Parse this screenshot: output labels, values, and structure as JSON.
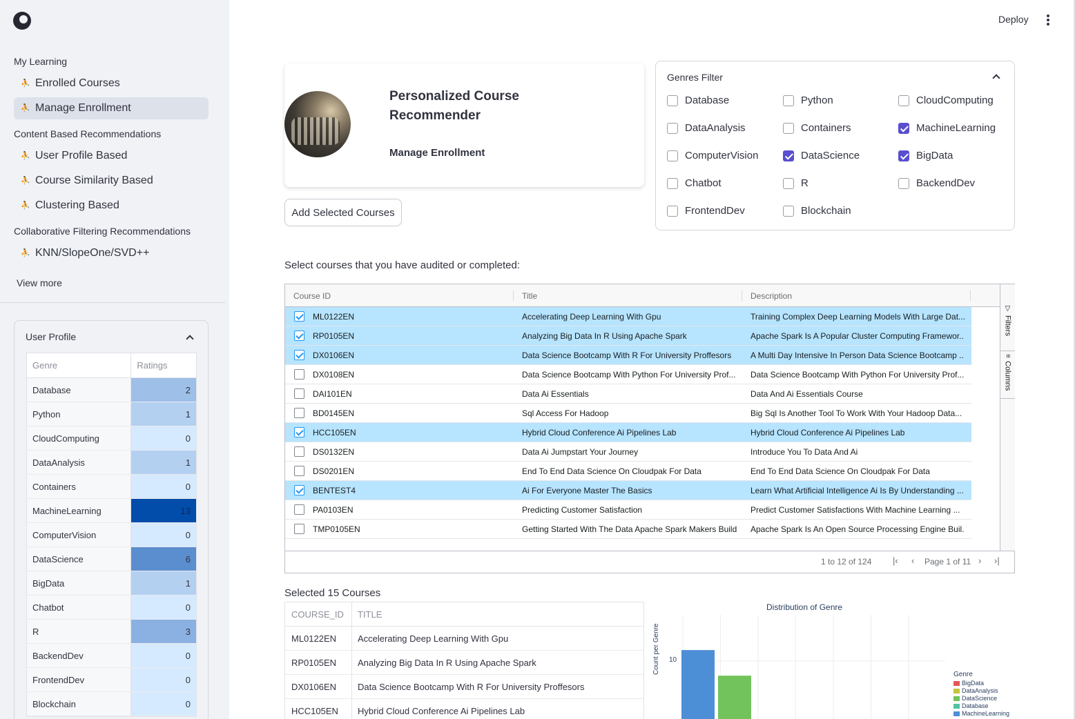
{
  "sidebar": {
    "sections": [
      {
        "title": "My Learning",
        "items": [
          {
            "label": "Enrolled Courses",
            "active": false
          },
          {
            "label": "Manage Enrollment",
            "active": true
          }
        ]
      },
      {
        "title": "Content Based Recommendations",
        "items": [
          {
            "label": "User Profile Based",
            "active": false
          },
          {
            "label": "Course Similarity Based",
            "active": false
          },
          {
            "label": "Clustering Based",
            "active": false
          }
        ]
      },
      {
        "title": "Collaborative Filtering Recommendations",
        "items": [
          {
            "label": "KNN/SlopeOne/SVD++",
            "active": false
          }
        ]
      }
    ],
    "view_more": "View more",
    "user_profile": {
      "title": "User Profile",
      "columns": [
        "Genre",
        "Ratings"
      ],
      "rows": [
        {
          "genre": "Database",
          "rating": 2
        },
        {
          "genre": "Python",
          "rating": 1
        },
        {
          "genre": "CloudComputing",
          "rating": 0
        },
        {
          "genre": "DataAnalysis",
          "rating": 1
        },
        {
          "genre": "Containers",
          "rating": 0
        },
        {
          "genre": "MachineLearning",
          "rating": 13
        },
        {
          "genre": "ComputerVision",
          "rating": 0
        },
        {
          "genre": "DataScience",
          "rating": 6
        },
        {
          "genre": "BigData",
          "rating": 1
        },
        {
          "genre": "Chatbot",
          "rating": 0
        },
        {
          "genre": "R",
          "rating": 3
        },
        {
          "genre": "BackendDev",
          "rating": 0
        },
        {
          "genre": "FrontendDev",
          "rating": 0
        },
        {
          "genre": "Blockchain",
          "rating": 0
        }
      ]
    }
  },
  "header": {
    "deploy": "Deploy"
  },
  "card": {
    "title": "Personalized Course Recommender",
    "subtitle": "Manage Enrollment"
  },
  "add_button": "Add Selected Courses",
  "genres_filter": {
    "title": "Genres Filter",
    "options": [
      {
        "label": "Database",
        "checked": false
      },
      {
        "label": "Python",
        "checked": false
      },
      {
        "label": "CloudComputing",
        "checked": false
      },
      {
        "label": "DataAnalysis",
        "checked": false
      },
      {
        "label": "Containers",
        "checked": false
      },
      {
        "label": "MachineLearning",
        "checked": true
      },
      {
        "label": "ComputerVision",
        "checked": false
      },
      {
        "label": "DataScience",
        "checked": true
      },
      {
        "label": "BigData",
        "checked": true
      },
      {
        "label": "Chatbot",
        "checked": false
      },
      {
        "label": "R",
        "checked": false
      },
      {
        "label": "BackendDev",
        "checked": false
      },
      {
        "label": "FrontendDev",
        "checked": false
      },
      {
        "label": "Blockchain",
        "checked": false
      }
    ]
  },
  "select_label": "Select courses that you have audited or completed:",
  "grid": {
    "columns": [
      "Course ID",
      "Title",
      "Description"
    ],
    "rows": [
      {
        "id": "ML0122EN",
        "title": "Accelerating Deep Learning With Gpu",
        "desc": "Training Complex Deep Learning Models With Large Dat...",
        "selected": true
      },
      {
        "id": "RP0105EN",
        "title": "Analyzing Big Data In R Using Apache Spark",
        "desc": "Apache Spark Is A Popular Cluster Computing Framewor...",
        "selected": true
      },
      {
        "id": "DX0106EN",
        "title": "Data Science Bootcamp With R For University Proffesors",
        "desc": "A Multi Day Intensive In Person Data Science Bootcamp ...",
        "selected": true
      },
      {
        "id": "DX0108EN",
        "title": "Data Science Bootcamp With Python For University Prof...",
        "desc": "Data Science Bootcamp With Python For University Prof...",
        "selected": false
      },
      {
        "id": "DAI101EN",
        "title": "Data Ai Essentials",
        "desc": "Data And Ai Essentials Course",
        "selected": false
      },
      {
        "id": "BD0145EN",
        "title": "Sql Access For Hadoop",
        "desc": "Big Sql Is Another Tool To Work With Your Hadoop Data...",
        "selected": false
      },
      {
        "id": "HCC105EN",
        "title": "Hybrid Cloud Conference Ai Pipelines Lab",
        "desc": "Hybrid Cloud Conference Ai Pipelines Lab",
        "selected": true
      },
      {
        "id": "DS0132EN",
        "title": "Data Ai Jumpstart Your Journey",
        "desc": "Introduce You To Data And Ai",
        "selected": false
      },
      {
        "id": "DS0201EN",
        "title": "End To End Data Science On Cloudpak For Data",
        "desc": "End To End Data Science On Cloudpak For Data",
        "selected": false
      },
      {
        "id": "BENTEST4",
        "title": "Ai For Everyone Master The Basics",
        "desc": "Learn What Artificial Intelligence Ai Is By Understanding ...",
        "selected": true
      },
      {
        "id": "PA0103EN",
        "title": "Predicting Customer Satisfaction",
        "desc": "Predict Customer Satisfactions With Machine Learning ...",
        "selected": false
      },
      {
        "id": "TMP0105EN",
        "title": "Getting Started With The Data Apache Spark Makers Build",
        "desc": "Apache Spark Is An Open Source Processing Engine Buil...",
        "selected": false
      }
    ],
    "side_tabs": [
      "Filters",
      "Columns"
    ],
    "footer": {
      "range": "1 to 12 of 124",
      "page": "Page 1 of 11"
    }
  },
  "selected": {
    "label": "Selected 15 Courses",
    "columns": [
      "COURSE_ID",
      "TITLE"
    ],
    "rows": [
      {
        "id": "ML0122EN",
        "title": "Accelerating Deep Learning With Gpu"
      },
      {
        "id": "RP0105EN",
        "title": "Analyzing Big Data In R Using Apache Spark"
      },
      {
        "id": "DX0106EN",
        "title": "Data Science Bootcamp With R For University Proffesors"
      },
      {
        "id": "HCC105EN",
        "title": "Hybrid Cloud Conference  Ai Pipelines Lab"
      }
    ]
  },
  "chart_data": {
    "type": "bar",
    "title": "Distribution of Genre",
    "ylabel": "Count per Genre",
    "yticks": [
      10
    ],
    "legend_title": "Genre",
    "legend_position": "right",
    "series": [
      {
        "name": "BigData",
        "color": "#e45756"
      },
      {
        "name": "DataAnalysis",
        "color": "#c5c43a"
      },
      {
        "name": "DataScience",
        "color": "#72c35c"
      },
      {
        "name": "Database",
        "color": "#52c2a0"
      },
      {
        "name": "MachineLearning",
        "color": "#4c8fd6"
      }
    ],
    "visible_bars": [
      {
        "series": "MachineLearning",
        "value": 13
      },
      {
        "series": "DataScience",
        "value": 6
      }
    ]
  },
  "colors": {
    "accent": "#5a4fcf",
    "row_selected": "#b7e4ff",
    "grid_check": "#2196f3"
  }
}
